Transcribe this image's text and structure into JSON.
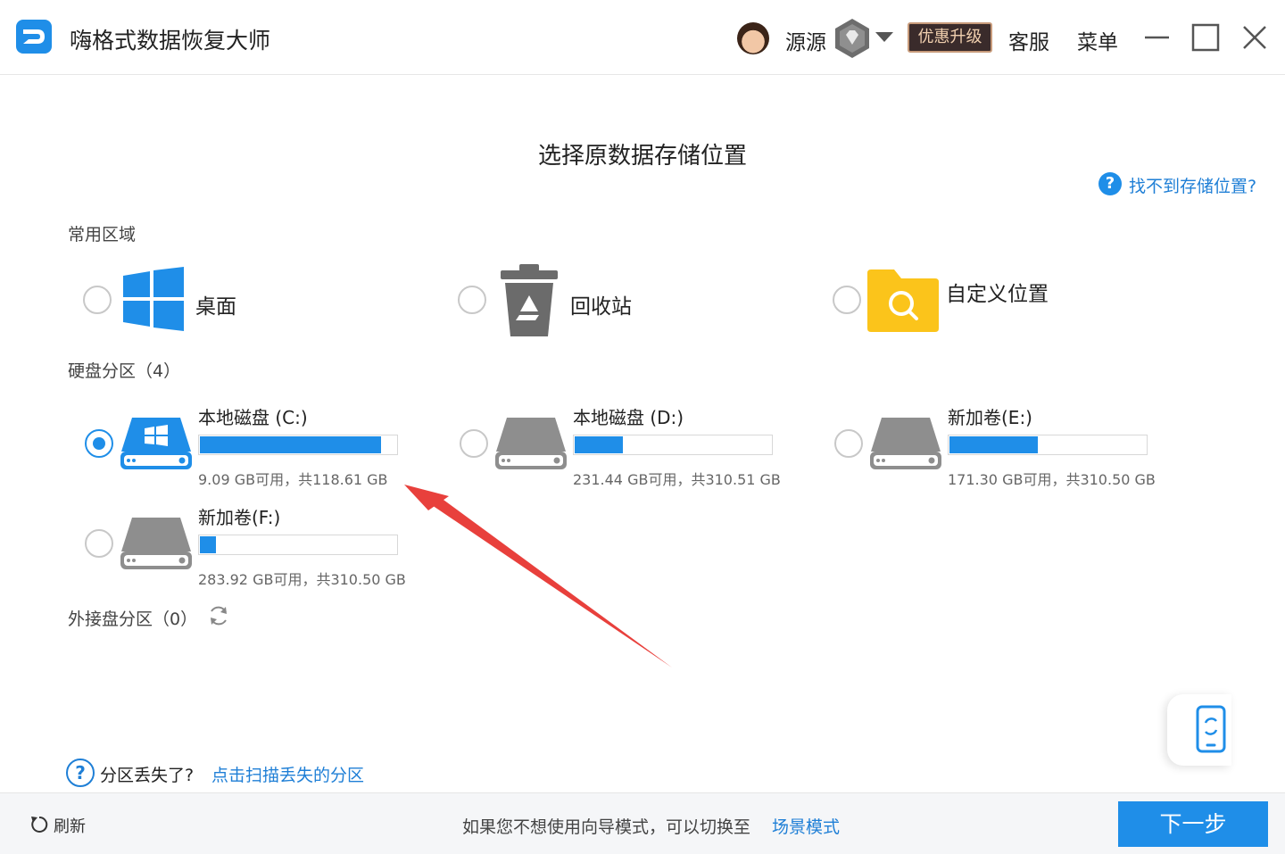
{
  "app": {
    "title": "嗨格式数据恢复大师"
  },
  "header": {
    "username": "源源",
    "upgrade_label": "优惠升级",
    "support_label": "客服",
    "menu_label": "菜单"
  },
  "main": {
    "heading": "选择原数据存储位置",
    "help_link": "找不到存储位置?",
    "common_section": "常用区域",
    "locations": [
      {
        "label": "桌面",
        "icon": "windows-icon"
      },
      {
        "label": "回收站",
        "icon": "recycle-bin-icon"
      },
      {
        "label": "自定义位置",
        "icon": "folder-search-icon"
      }
    ],
    "disk_section": "硬盘分区（4）",
    "drives": [
      {
        "name": "本地磁盘 (C:)",
        "info": "9.09 GB可用，共118.61 GB",
        "used_fraction": 0.923,
        "selected": true
      },
      {
        "name": "本地磁盘 (D:)",
        "info": "231.44 GB可用，共310.51 GB",
        "used_fraction": 0.245,
        "selected": false
      },
      {
        "name": "新加卷(E:)",
        "info": "171.30 GB可用，共310.50 GB",
        "used_fraction": 0.45,
        "selected": false
      },
      {
        "name": "新加卷(F:)",
        "info": "283.92 GB可用，共310.50 GB",
        "used_fraction": 0.08,
        "selected": false
      }
    ],
    "external_section": "外接盘分区（0）",
    "lost_partition_text": "分区丢失了?",
    "lost_partition_link": "点击扫描丢失的分区"
  },
  "footer": {
    "refresh_label": "刷新",
    "hint": "如果您不想使用向导模式，可以切换至",
    "scene_link": "场景模式",
    "next_label": "下一步"
  },
  "colors": {
    "accent": "#1f8ee8",
    "link": "#1f7fd6",
    "annotation_arrow": "#e8403c"
  }
}
